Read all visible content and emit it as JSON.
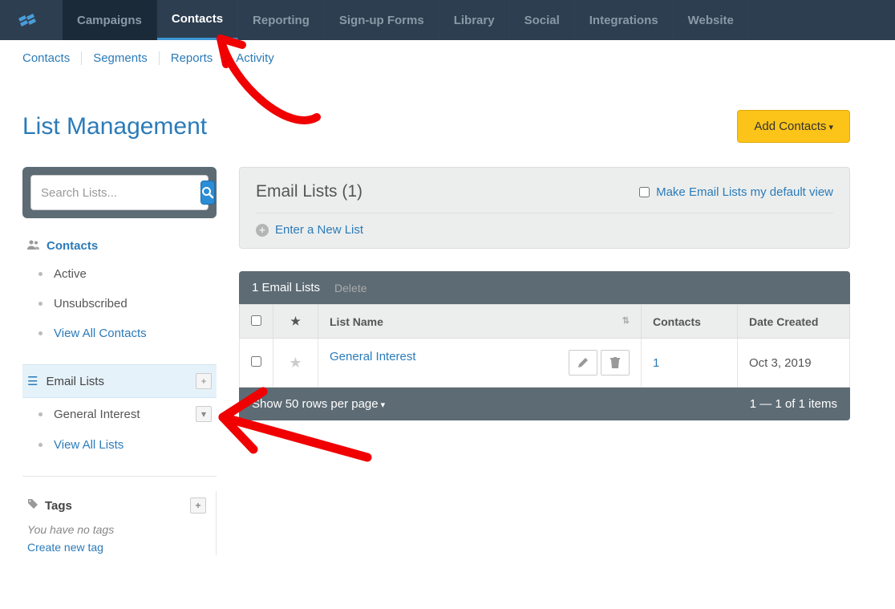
{
  "topnav": {
    "items": [
      {
        "label": "Campaigns"
      },
      {
        "label": "Contacts"
      },
      {
        "label": "Reporting"
      },
      {
        "label": "Sign-up Forms"
      },
      {
        "label": "Library"
      },
      {
        "label": "Social"
      },
      {
        "label": "Integrations"
      },
      {
        "label": "Website"
      }
    ]
  },
  "subnav": {
    "items": [
      "Contacts",
      "Segments",
      "Reports",
      "Activity"
    ]
  },
  "page": {
    "title": "List Management",
    "add_button": "Add Contacts"
  },
  "search": {
    "placeholder": "Search Lists..."
  },
  "sidebar": {
    "contacts": {
      "head": "Contacts",
      "items": [
        "Active",
        "Unsubscribed",
        "View All Contacts"
      ]
    },
    "email_lists": {
      "head": "Email Lists",
      "items": [
        "General Interest",
        "View All Lists"
      ]
    },
    "tags": {
      "head": "Tags",
      "empty": "You have no tags",
      "create": "Create new tag"
    }
  },
  "panel": {
    "title": "Email Lists (1)",
    "default_label": "Make Email Lists my default view",
    "enter_new": "Enter a New List"
  },
  "table": {
    "count_label": "1 Email Lists",
    "delete": "Delete",
    "headers": {
      "list_name": "List Name",
      "contacts": "Contacts",
      "date_created": "Date Created"
    },
    "rows": [
      {
        "name": "General Interest",
        "contacts": "1",
        "date": "Oct 3, 2019"
      }
    ],
    "footer": {
      "rows_per": "Show 50 rows per page",
      "pagination": "1 — 1 of 1 items"
    }
  }
}
